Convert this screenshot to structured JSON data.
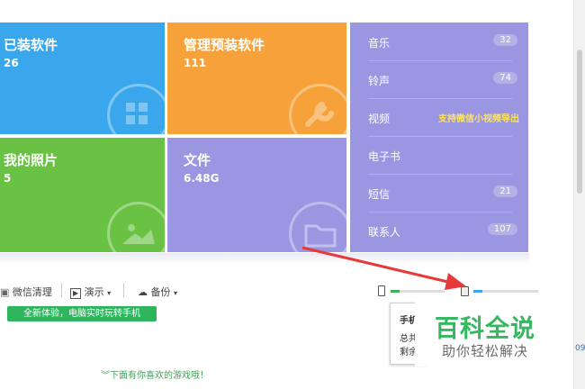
{
  "tiles": [
    {
      "label": "已装软件",
      "value": "26",
      "color": "#3aa7ec"
    },
    {
      "label": "管理预装软件",
      "value": "111",
      "color": "#f6a13a"
    },
    {
      "label": "我的照片",
      "value": "5",
      "color": "#6ac245"
    },
    {
      "label": "文件",
      "value": "6.48G",
      "color": "#9b96e1"
    }
  ],
  "media": {
    "items": [
      {
        "label": "音乐",
        "count": "32"
      },
      {
        "label": "铃声",
        "count": "74"
      },
      {
        "label": "视频",
        "promo": "支持微信小视频导出"
      },
      {
        "label": "电子书"
      },
      {
        "label": "短信",
        "count": "21"
      },
      {
        "label": "联系人",
        "count": "107"
      }
    ]
  },
  "toolbar": {
    "wechat_clean": "微信清理",
    "demo": "演示",
    "backup": "备份"
  },
  "banner": "全新体验，电脑实时玩转手机",
  "bottom_hint": "下面有你喜欢的游戏哦！",
  "popup": {
    "line1": "手机",
    "line2": "总共",
    "line3": "剩余"
  },
  "watermark": {
    "title": "百科全说",
    "subtitle": "助你轻松解决"
  },
  "side_text": "09"
}
